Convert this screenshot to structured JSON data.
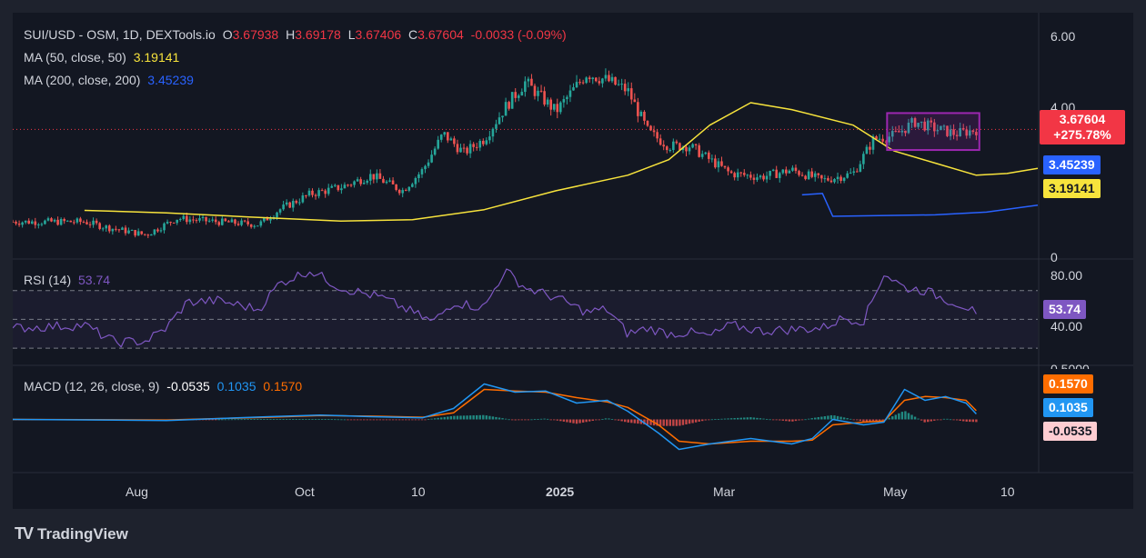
{
  "legend": {
    "symbol": "SUI/USD - OSM, 1D, DEXTools.io",
    "open_label": "O",
    "open": "3.67938",
    "high_label": "H",
    "high": "3.69178",
    "low_label": "L",
    "low": "3.67406",
    "close_label": "C",
    "close": "3.67604",
    "change": "-0.0033 (-0.09%)",
    "ma50_label": "MA (50, close, 50)",
    "ma50_value": "3.19141",
    "ma200_label": "MA (200, close, 200)",
    "ma200_value": "3.45239",
    "rsi_label": "RSI (14)",
    "rsi_value": "53.74",
    "macd_label": "MACD (12, 26, close, 9)",
    "macd_hist": "-0.0535",
    "macd_line": "0.1035",
    "macd_signal": "0.1570"
  },
  "badges": {
    "price": "3.67604",
    "price_change": "+275.78%",
    "ma200": "3.45239",
    "ma50": "3.19141",
    "rsi": "53.74",
    "macd_signal": "0.1570",
    "macd_line": "0.1035",
    "macd_hist": "-0.0535"
  },
  "colors": {
    "up": "#26a69a",
    "down": "#ef5350",
    "ma50": "#f7e33c",
    "ma200": "#2962ff",
    "rsi": "#7e57c2",
    "macd": "#2196f3",
    "signal": "#ff6d00",
    "box": "#9c27b0"
  },
  "brand": "TradingView",
  "chart_data": {
    "type": "candlestick",
    "price_axis": {
      "ticks": [
        "6.00",
        "4.00",
        "0"
      ],
      "ylim": [
        0,
        6.4
      ]
    },
    "rsi_axis": {
      "ticks": [
        "80.00",
        "40.00"
      ],
      "levels": [
        70,
        50,
        30
      ]
    },
    "macd_axis": {
      "ticks": [
        "0.5000"
      ]
    },
    "x_ticks": [
      "Aug",
      "Oct",
      "10",
      "2025",
      "Mar",
      "May",
      "10"
    ],
    "ma50_points": [
      [
        0.07,
        1.33
      ],
      [
        0.15,
        1.26
      ],
      [
        0.23,
        1.14
      ],
      [
        0.32,
        1.02
      ],
      [
        0.39,
        1.06
      ],
      [
        0.46,
        1.35
      ],
      [
        0.53,
        1.9
      ],
      [
        0.6,
        2.35
      ],
      [
        0.64,
        2.8
      ],
      [
        0.68,
        3.8
      ],
      [
        0.72,
        4.45
      ],
      [
        0.76,
        4.25
      ],
      [
        0.82,
        3.8
      ],
      [
        0.86,
        3.05
      ],
      [
        0.9,
        2.7
      ],
      [
        0.94,
        2.35
      ],
      [
        0.97,
        2.4
      ],
      [
        1.0,
        2.55
      ]
    ],
    "ma200_points": [
      [
        0.77,
        1.78
      ],
      [
        0.79,
        1.82
      ],
      [
        0.8,
        1.16
      ],
      [
        0.9,
        1.2
      ],
      [
        0.95,
        1.28
      ],
      [
        1.0,
        1.48
      ]
    ],
    "price_path": [
      [
        0,
        1.0
      ],
      [
        0.07,
        1.0
      ],
      [
        0.09,
        0.85
      ],
      [
        0.13,
        0.62
      ],
      [
        0.16,
        1.1
      ],
      [
        0.2,
        1.0
      ],
      [
        0.24,
        0.92
      ],
      [
        0.26,
        1.35
      ],
      [
        0.29,
        1.8
      ],
      [
        0.32,
        2.0
      ],
      [
        0.35,
        2.35
      ],
      [
        0.38,
        1.9
      ],
      [
        0.4,
        2.5
      ],
      [
        0.42,
        3.55
      ],
      [
        0.44,
        3.0
      ],
      [
        0.46,
        3.4
      ],
      [
        0.48,
        4.3
      ],
      [
        0.5,
        5.05
      ],
      [
        0.53,
        4.2
      ],
      [
        0.56,
        5.3
      ],
      [
        0.58,
        5.1
      ],
      [
        0.6,
        4.8
      ],
      [
        0.62,
        3.6
      ],
      [
        0.64,
        3.2
      ],
      [
        0.66,
        3.2
      ],
      [
        0.7,
        2.4
      ],
      [
        0.73,
        2.3
      ],
      [
        0.76,
        2.5
      ],
      [
        0.79,
        2.2
      ],
      [
        0.82,
        2.4
      ],
      [
        0.84,
        3.4
      ],
      [
        0.86,
        3.5
      ],
      [
        0.88,
        3.9
      ],
      [
        0.9,
        3.7
      ],
      [
        0.92,
        3.55
      ],
      [
        0.94,
        3.67
      ]
    ],
    "rsi_points": [
      [
        0,
        44
      ],
      [
        0.07,
        46
      ],
      [
        0.1,
        34
      ],
      [
        0.13,
        35
      ],
      [
        0.15,
        44
      ],
      [
        0.17,
        62
      ],
      [
        0.2,
        63
      ],
      [
        0.24,
        57
      ],
      [
        0.26,
        75
      ],
      [
        0.29,
        84
      ],
      [
        0.32,
        72
      ],
      [
        0.36,
        65
      ],
      [
        0.39,
        55
      ],
      [
        0.41,
        48
      ],
      [
        0.43,
        62
      ],
      [
        0.46,
        58
      ],
      [
        0.48,
        84
      ],
      [
        0.5,
        72
      ],
      [
        0.53,
        65
      ],
      [
        0.56,
        55
      ],
      [
        0.58,
        57
      ],
      [
        0.6,
        40
      ],
      [
        0.62,
        44
      ],
      [
        0.64,
        40
      ],
      [
        0.66,
        41
      ],
      [
        0.68,
        38
      ],
      [
        0.7,
        46
      ],
      [
        0.73,
        42
      ],
      [
        0.76,
        43
      ],
      [
        0.79,
        44
      ],
      [
        0.81,
        51
      ],
      [
        0.83,
        49
      ],
      [
        0.85,
        82
      ],
      [
        0.87,
        72
      ],
      [
        0.89,
        70
      ],
      [
        0.91,
        64
      ],
      [
        0.93,
        59
      ],
      [
        0.94,
        53.74
      ]
    ],
    "macd_points": [
      [
        0,
        0
      ],
      [
        0.15,
        -0.02
      ],
      [
        0.25,
        0.05
      ],
      [
        0.3,
        0.08
      ],
      [
        0.35,
        0.05
      ],
      [
        0.4,
        0.03
      ],
      [
        0.43,
        0.2
      ],
      [
        0.46,
        0.65
      ],
      [
        0.49,
        0.5
      ],
      [
        0.52,
        0.52
      ],
      [
        0.55,
        0.3
      ],
      [
        0.58,
        0.35
      ],
      [
        0.6,
        0.15
      ],
      [
        0.63,
        -0.25
      ],
      [
        0.65,
        -0.55
      ],
      [
        0.68,
        -0.45
      ],
      [
        0.72,
        -0.35
      ],
      [
        0.76,
        -0.45
      ],
      [
        0.78,
        -0.35
      ],
      [
        0.8,
        0.0
      ],
      [
        0.83,
        -0.1
      ],
      [
        0.85,
        -0.05
      ],
      [
        0.87,
        0.55
      ],
      [
        0.89,
        0.35
      ],
      [
        0.91,
        0.42
      ],
      [
        0.93,
        0.3
      ],
      [
        0.94,
        0.1
      ]
    ],
    "signal_points": [
      [
        0,
        0
      ],
      [
        0.15,
        -0.01
      ],
      [
        0.25,
        0.04
      ],
      [
        0.3,
        0.07
      ],
      [
        0.35,
        0.06
      ],
      [
        0.4,
        0.04
      ],
      [
        0.43,
        0.12
      ],
      [
        0.46,
        0.55
      ],
      [
        0.49,
        0.52
      ],
      [
        0.52,
        0.5
      ],
      [
        0.55,
        0.4
      ],
      [
        0.58,
        0.32
      ],
      [
        0.6,
        0.22
      ],
      [
        0.63,
        -0.1
      ],
      [
        0.65,
        -0.4
      ],
      [
        0.68,
        -0.45
      ],
      [
        0.72,
        -0.4
      ],
      [
        0.76,
        -0.4
      ],
      [
        0.78,
        -0.38
      ],
      [
        0.8,
        -0.1
      ],
      [
        0.83,
        -0.05
      ],
      [
        0.85,
        -0.03
      ],
      [
        0.87,
        0.35
      ],
      [
        0.89,
        0.42
      ],
      [
        0.91,
        0.4
      ],
      [
        0.93,
        0.35
      ],
      [
        0.94,
        0.16
      ]
    ]
  }
}
